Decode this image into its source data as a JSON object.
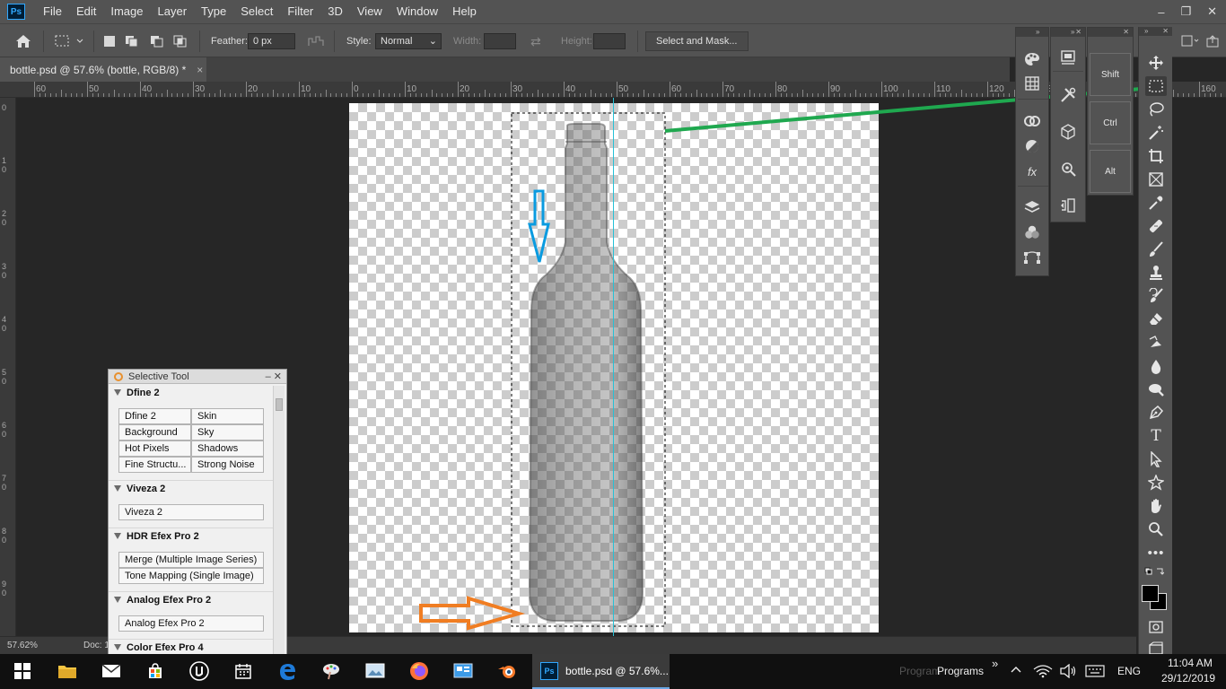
{
  "menubar": {
    "app_logo": "Ps",
    "items": [
      "File",
      "Edit",
      "Image",
      "Layer",
      "Type",
      "Select",
      "Filter",
      "3D",
      "View",
      "Window",
      "Help"
    ],
    "window_controls": [
      "–",
      "❐",
      "✕"
    ]
  },
  "options": {
    "feather_label": "Feather:",
    "feather_value": "0 px",
    "style_label": "Style:",
    "style_value": "Normal",
    "width_label": "Width:",
    "height_label": "Height:",
    "select_mask": "Select and Mask..."
  },
  "tab": {
    "title": "bottle.psd @ 57.6% (bottle, RGB/8) *",
    "close": "×"
  },
  "ruler": {
    "top_labels": [
      "60",
      "50",
      "40",
      "30",
      "20",
      "10",
      "0",
      "10",
      "20",
      "30",
      "40",
      "50",
      "60",
      "70",
      "80",
      "90",
      "100",
      "110",
      "120",
      "130",
      "140",
      "150",
      "160"
    ],
    "left_labels": [
      "0",
      "1 0",
      "2 0",
      "3 0",
      "4 0",
      "5 0",
      "6 0",
      "7 0",
      "8 0",
      "9 0"
    ]
  },
  "status": {
    "zoom": "57.62%",
    "doc": "Doc: 1"
  },
  "selective_tool": {
    "title": "Selective Tool",
    "controls": "–  ✕",
    "groups": [
      {
        "name": "Dfine 2",
        "buttons": [
          "Dfine 2",
          "Skin",
          "Background",
          "Sky",
          "Hot Pixels",
          "Shadows",
          "Fine Structu...",
          "Strong Noise"
        ]
      },
      {
        "name": "Viveza 2",
        "buttons": [
          "Viveza 2"
        ]
      },
      {
        "name": "HDR Efex Pro 2",
        "buttons": [
          "Merge (Multiple Image Series)",
          "Tone Mapping (Single Image)"
        ]
      },
      {
        "name": "Analog Efex Pro 2",
        "buttons": [
          "Analog Efex Pro 2"
        ]
      },
      {
        "name": "Color Efex Pro 4",
        "buttons": []
      }
    ]
  },
  "keys_panel": {
    "shift": "Shift",
    "ctrl": "Ctrl",
    "alt": "Alt"
  },
  "taskbar": {
    "active_window": "bottle.psd @ 57.6%...",
    "active_logo": "Ps",
    "programs_ghost": "Program",
    "programs": "Programs",
    "chevron": "»",
    "language": "ENG",
    "time": "11:04 AM",
    "date": "29/12/2019"
  },
  "colors": {
    "accent_green": "#1fa84f",
    "accent_blue": "#0a9be0",
    "accent_orange": "#f07d22",
    "guide_cyan": "#27c1d6"
  }
}
